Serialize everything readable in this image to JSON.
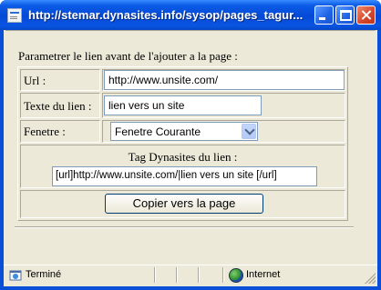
{
  "window": {
    "title": "http://stemar.dynasites.info/sysop/pages_tagur..."
  },
  "form": {
    "heading": "Parametrer le lien avant de l'ajouter a la page :",
    "url_label": "Url :",
    "url_value": "http://www.unsite.com/",
    "link_text_label": "Texte du lien :",
    "link_text_value": "lien vers un site",
    "window_label": "Fenetre :",
    "window_value": "Fenetre Courante",
    "tag_label": "Tag Dynasites du lien :",
    "tag_value": "[url]http://www.unsite.com/|lien vers un site [/url]",
    "copy_button": "Copier vers la page"
  },
  "statusbar": {
    "status": "Terminé",
    "zone": "Internet"
  },
  "colors": {
    "titlebar": "#0449d6",
    "dialog_bg": "#ece9d8",
    "input_border": "#7f9db9"
  }
}
